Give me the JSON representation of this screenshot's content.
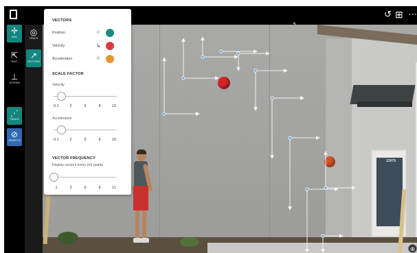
{
  "rail": {
    "tools": [
      {
        "name": "add",
        "label": "ADD",
        "icon": "crosshair-icon"
      },
      {
        "name": "track",
        "label": "TRACK",
        "icon": "target-icon"
      },
      {
        "name": "edit",
        "label": "EDIT",
        "icon": "pointer-icon"
      },
      {
        "name": "vectors",
        "label": "VECTORS",
        "icon": "arrow-icon"
      },
      {
        "name": "system",
        "label": "SYSTEM",
        "icon": "axes-icon"
      },
      {
        "name": "trails",
        "label": "TRAILS",
        "icon": "trail-icon"
      },
      {
        "name": "objects",
        "label": "OBJECTS",
        "icon": "objects-icon"
      }
    ]
  },
  "topbar": {
    "icons": [
      "document-icon",
      "undo-icon",
      "layout-icon",
      "more-icon"
    ],
    "glyphs": {
      "undo": "↺",
      "layout": "⊞",
      "more": "⋯",
      "cursor": "↖"
    }
  },
  "panel": {
    "vectors_title": "VECTORS",
    "rows": [
      {
        "label": "Position",
        "visibility_icon": "eye-off-icon",
        "color": "#1b8a85"
      },
      {
        "label": "Velocity",
        "visibility_icon": "axis-arrow-icon",
        "color": "#d83a3f"
      },
      {
        "label": "Acceleration",
        "visibility_icon": "eye-off-icon",
        "color": "#e49531"
      }
    ],
    "scale_title": "SCALE FACTOR",
    "velocity_label": "Velocity",
    "velocity_ticks": [
      "0.1",
      "2",
      "5",
      "8",
      "10"
    ],
    "velocity_value_fraction": 0.12,
    "acceleration_label": "Acceleration",
    "acceleration_ticks": [
      "0.1",
      "2",
      "5",
      "8",
      "10"
    ],
    "acceleration_value_fraction": 0.12,
    "frequency_title": "VECTOR FREQUENCY",
    "frequency_note": "Display vectors every (m) points",
    "frequency_ticks": [
      "1",
      "3",
      "6",
      "8",
      "11"
    ],
    "frequency_value_fraction": 0.0
  },
  "scene": {
    "door_number": "13979"
  },
  "zoom_glyph": "⊕"
}
